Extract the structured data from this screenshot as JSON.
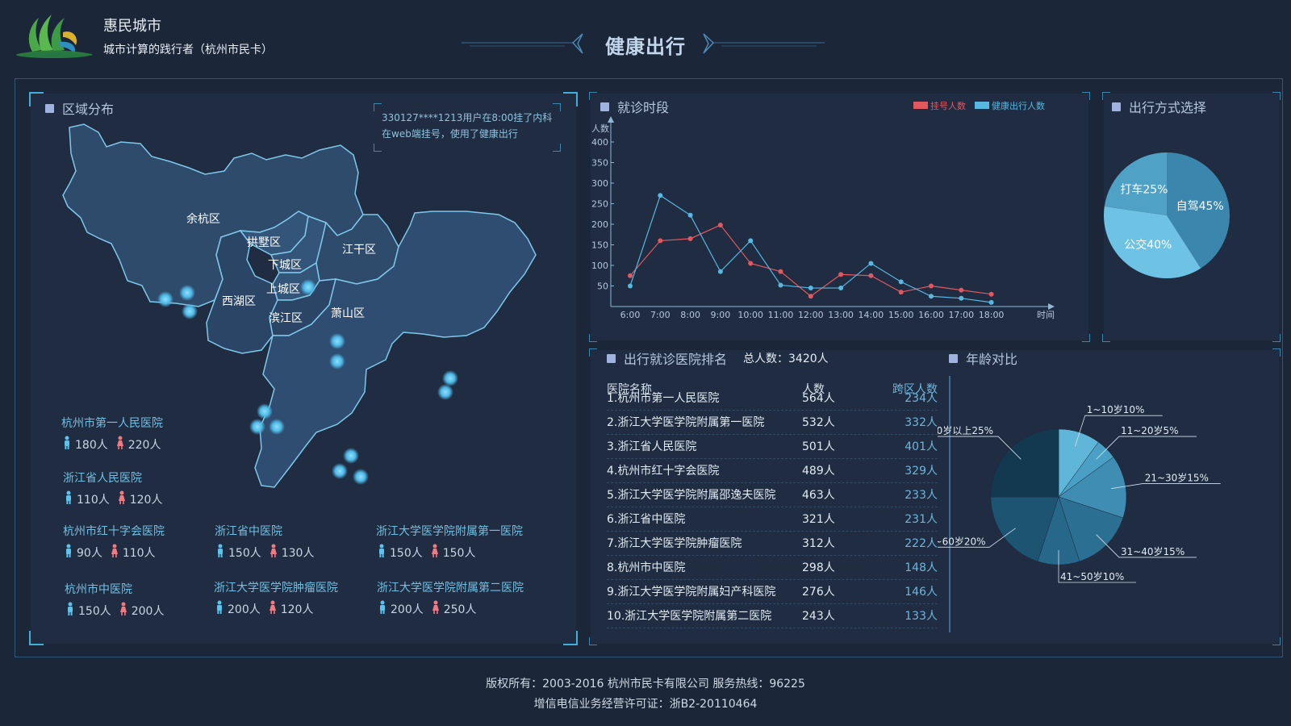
{
  "header": {
    "brand_name": "惠民城市",
    "brand_slogan": "城市计算的践行者（杭州市民卡）",
    "page_title": "健康出行"
  },
  "region_panel": {
    "title": "区域分布",
    "tooltip_line1": "330127****1213用户在8:00挂了内科",
    "tooltip_line2": "在web端挂号，使用了健康出行",
    "districts": [
      "余杭区",
      "拱墅区",
      "下城区",
      "江干区",
      "上城区",
      "西湖区",
      "滨江区",
      "萧山区"
    ],
    "hospitals": [
      {
        "name": "杭州市第一人民医院",
        "male": "180人",
        "female": "220人"
      },
      {
        "name": "浙江省人民医院",
        "male": "110人",
        "female": "120人"
      },
      {
        "name": "杭州市红十字会医院",
        "male": "90人",
        "female": "110人"
      },
      {
        "name": "浙江省中医院",
        "male": "150人",
        "female": "130人"
      },
      {
        "name": "浙江大学医学院附属第一医院",
        "male": "150人",
        "female": "150人"
      },
      {
        "name": "杭州市中医院",
        "male": "150人",
        "female": "200人"
      },
      {
        "name": "浙江大学医学院肿瘤医院",
        "male": "200人",
        "female": "120人"
      },
      {
        "name": "浙江大学医学院附属第二医院",
        "male": "200人",
        "female": "250人"
      }
    ],
    "colors": {
      "male": "#5cc3ec",
      "female": "#ee7b84"
    }
  },
  "time_panel": {
    "title": "就诊时段",
    "chart_data": {
      "type": "line",
      "ylabel": "人数",
      "xlabel": "时间",
      "ylim": [
        0,
        400
      ],
      "yticks": [
        50,
        100,
        150,
        200,
        250,
        300,
        350,
        400
      ],
      "categories": [
        "6:00",
        "7:00",
        "8:00",
        "9:00",
        "10:00",
        "11:00",
        "12:00",
        "13:00",
        "14:00",
        "15:00",
        "16:00",
        "17:00",
        "18:00"
      ],
      "legend_position": "top-right",
      "series": [
        {
          "name": "挂号人数",
          "color": "#e2585f",
          "values": [
            75,
            160,
            165,
            198,
            105,
            85,
            25,
            78,
            75,
            35,
            50,
            40,
            30
          ]
        },
        {
          "name": "健康出行人数",
          "color": "#57b8e2",
          "values": [
            50,
            270,
            222,
            85,
            160,
            52,
            45,
            45,
            105,
            60,
            25,
            20,
            10
          ]
        }
      ]
    }
  },
  "mode_panel": {
    "title": "出行方式选择",
    "chart_data": {
      "type": "pie",
      "slices": [
        {
          "label": "自驾45%",
          "value": 45,
          "color": "#3b86ad"
        },
        {
          "label": "公交40%",
          "value": 40,
          "color": "#6ec3e4"
        },
        {
          "label": "打车25%",
          "value": 25,
          "color": "#4fa1c6"
        }
      ]
    }
  },
  "rank_panel": {
    "title": "出行就诊医院排名",
    "total_label": "总人数：3420人",
    "headers": [
      "医院名称",
      "人数",
      "跨区人数"
    ],
    "rows": [
      [
        "1.杭州市第一人民医院",
        "564人",
        "234人"
      ],
      [
        "2.浙江大学医学院附属第一医院",
        "532人",
        "332人"
      ],
      [
        "3.浙江省人民医院",
        "501人",
        "401人"
      ],
      [
        "4.杭州市红十字会医院",
        "489人",
        "329人"
      ],
      [
        "5.浙江大学医学院附属邵逸夫医院",
        "463人",
        "233人"
      ],
      [
        "6.浙江省中医院",
        "321人",
        "231人"
      ],
      [
        "7.浙江大学医学院肿瘤医院",
        "312人",
        "222人"
      ],
      [
        "8.杭州市中医院",
        "298人",
        "148人"
      ],
      [
        "9.浙江大学医学院附属妇产科医院",
        "276人",
        "146人"
      ],
      [
        "10.浙江大学医学院附属第二医院",
        "243人",
        "133人"
      ]
    ]
  },
  "age_panel": {
    "title": "年龄对比",
    "chart_data": {
      "type": "pie",
      "slices": [
        {
          "label": "1~10岁10%",
          "value": 10,
          "color": "#5fb6d8"
        },
        {
          "label": "11~20岁5%",
          "value": 5,
          "color": "#4a9fc4"
        },
        {
          "label": "21~30岁15%",
          "value": 15,
          "color": "#3f8db3"
        },
        {
          "label": "31~40岁15%",
          "value": 15,
          "color": "#2b6f92"
        },
        {
          "label": "41~50岁10%",
          "value": 10,
          "color": "#27688a"
        },
        {
          "label": "51~60岁20%",
          "value": 20,
          "color": "#1d5472"
        },
        {
          "label": "60岁以上25%",
          "value": 25,
          "color": "#12394f"
        }
      ]
    }
  },
  "footer": {
    "copyright": "版权所有：2003-2016  杭州市民卡有限公司  服务热线：96225",
    "license": "增信电信业务经营许可证：浙B2-20110464"
  }
}
